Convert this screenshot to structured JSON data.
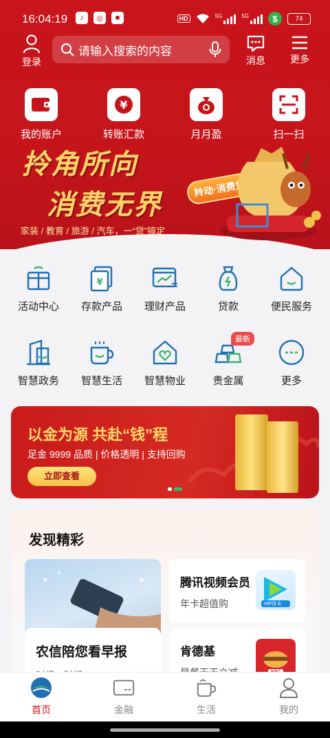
{
  "status_bar": {
    "time": "16:04:19",
    "hd": "HD",
    "net1": "5G",
    "net2": "5G",
    "battery": "74"
  },
  "top_bar": {
    "login_label": "登录",
    "search_placeholder": "请输入搜索的内容",
    "messages_label": "消息",
    "more_label": "更多"
  },
  "quick_actions": [
    {
      "label": "我的账户",
      "icon": "wallet-icon"
    },
    {
      "label": "转账汇款",
      "icon": "yuan-transfer-icon"
    },
    {
      "label": "月月盈",
      "icon": "money-bag-icon"
    },
    {
      "label": "扫一扫",
      "icon": "scan-icon"
    }
  ],
  "hero_banner": {
    "title_line1": "拎角所向",
    "title_line2": "消费无界",
    "tag": "羚动·消费贷",
    "subtitle": "家装 / 教育 / 旅游 / 汽车，一“贷”搞定"
  },
  "services": [
    {
      "label": "活动中心",
      "icon": "gift-box-icon"
    },
    {
      "label": "存款产品",
      "icon": "deposit-icon"
    },
    {
      "label": "理财产品",
      "icon": "wealth-chart-icon"
    },
    {
      "label": "贷款",
      "icon": "loan-bag-icon"
    },
    {
      "label": "便民服务",
      "icon": "house-service-icon"
    },
    {
      "label": "智慧政务",
      "icon": "government-building-icon"
    },
    {
      "label": "智慧生活",
      "icon": "coffee-cup-icon"
    },
    {
      "label": "智慧物业",
      "icon": "home-heart-icon"
    },
    {
      "label": "贵金属",
      "icon": "gold-bars-icon",
      "badge": "最新"
    },
    {
      "label": "更多",
      "icon": "more-dots-icon"
    }
  ],
  "gold_banner": {
    "title": "以金为源 共赴“钱”程",
    "subtitle": "足金 9999 品质 | 价格透明 | 支持回购",
    "button": "立即查看"
  },
  "discover": {
    "title": "发现精彩",
    "big_card": {
      "title": "农信陪您看早报",
      "subtitle": "时讯 · 财经"
    },
    "cards": [
      {
        "title": "腾讯视频会员",
        "subtitle": "年卡超值购",
        "icon_label": "VIP月卡"
      },
      {
        "title": "肯德基",
        "subtitle": "早餐天天立减",
        "icon_label": "KFC"
      }
    ]
  },
  "bottom_nav": [
    {
      "label": "首页",
      "active": true
    },
    {
      "label": "金融",
      "active": false
    },
    {
      "label": "生活",
      "active": false
    },
    {
      "label": "我的",
      "active": false
    }
  ],
  "colors": {
    "brand_red": "#c5151b",
    "service_icon_blue": "#1f6fb2",
    "service_icon_green": "#3cb371",
    "gold": "#ffd96a"
  }
}
